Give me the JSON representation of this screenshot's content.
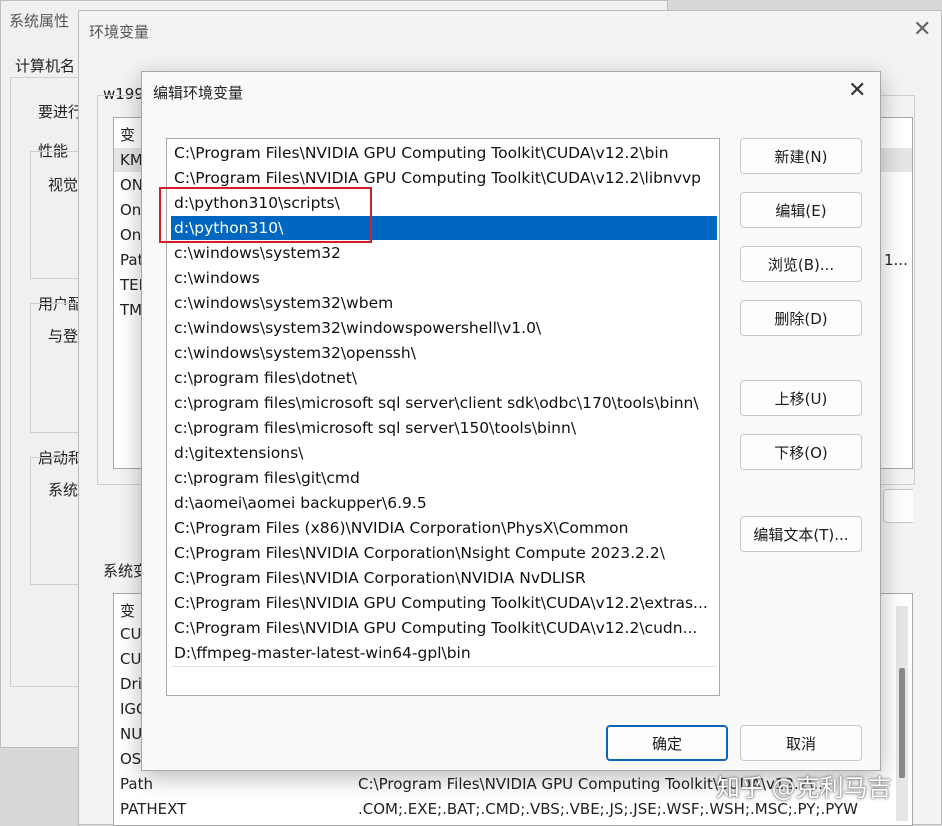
{
  "sys_props": {
    "title": "系统属性",
    "tab_computer_name": "计算机名",
    "label_must": "要进行",
    "label_perf": "性能",
    "label_visual": "视觉",
    "label_user_profile": "用户配",
    "label_login": "与登",
    "label_startup": "启动和",
    "label_system": "系统"
  },
  "env_vars": {
    "title": "环境变量",
    "user_section_label": "w199",
    "user_col_header": "变",
    "user_vars": [
      "KM",
      "ON",
      "On",
      "On",
      "Pat",
      "TEI",
      "TM"
    ],
    "user_value_partial": "1...",
    "sys_section_label": "系统变",
    "sys_col_header": "变",
    "sys_vars": [
      "CU",
      "CU",
      "Dri",
      "IGC",
      "NU",
      "OS"
    ],
    "path_row": {
      "name": "Path",
      "value": "C:\\Program Files\\NVIDIA GPU Computing Toolkit\\CUDA\\v12.2\\..."
    },
    "pathext_row": {
      "name": "PATHEXT",
      "value": ".COM;.EXE;.BAT;.CMD;.VBS;.VBE;.JS;.JSE;.WSF;.WSH;.MSC;.PY;.PYW"
    }
  },
  "edit_dialog": {
    "title": "编辑环境变量",
    "paths": [
      "C:\\Program Files\\NVIDIA GPU Computing Toolkit\\CUDA\\v12.2\\bin",
      "C:\\Program Files\\NVIDIA GPU Computing Toolkit\\CUDA\\v12.2\\libnvvp",
      "d:\\python310\\scripts\\",
      "d:\\python310\\",
      "c:\\windows\\system32",
      "c:\\windows",
      "c:\\windows\\system32\\wbem",
      "c:\\windows\\system32\\windowspowershell\\v1.0\\",
      "c:\\windows\\system32\\openssh\\",
      "c:\\program files\\dotnet\\",
      "c:\\program files\\microsoft sql server\\client sdk\\odbc\\170\\tools\\binn\\",
      "c:\\program files\\microsoft sql server\\150\\tools\\binn\\",
      "d:\\gitextensions\\",
      "c:\\program files\\git\\cmd",
      "d:\\aomei\\aomei backupper\\6.9.5",
      "C:\\Program Files (x86)\\NVIDIA Corporation\\PhysX\\Common",
      "C:\\Program Files\\NVIDIA Corporation\\Nsight Compute 2023.2.2\\",
      "C:\\Program Files\\NVIDIA Corporation\\NVIDIA NvDLISR",
      "C:\\Program Files\\NVIDIA GPU Computing Toolkit\\CUDA\\v12.2\\extras...",
      "C:\\Program Files\\NVIDIA GPU Computing Toolkit\\CUDA\\v12.2\\cudn...",
      "D:\\ffmpeg-master-latest-win64-gpl\\bin"
    ],
    "selected_index": 3,
    "buttons": {
      "new": "新建(N)",
      "edit": "编辑(E)",
      "browse": "浏览(B)...",
      "delete": "删除(D)",
      "move_up": "上移(U)",
      "move_down": "下移(O)",
      "edit_text": "编辑文本(T)...",
      "ok": "确定",
      "cancel": "取消"
    }
  },
  "watermark": "知乎 @克利马吉",
  "colors": {
    "selection": "#0067c0",
    "highlight_box": "#d0202a",
    "primary_border": "#0a64b7"
  }
}
